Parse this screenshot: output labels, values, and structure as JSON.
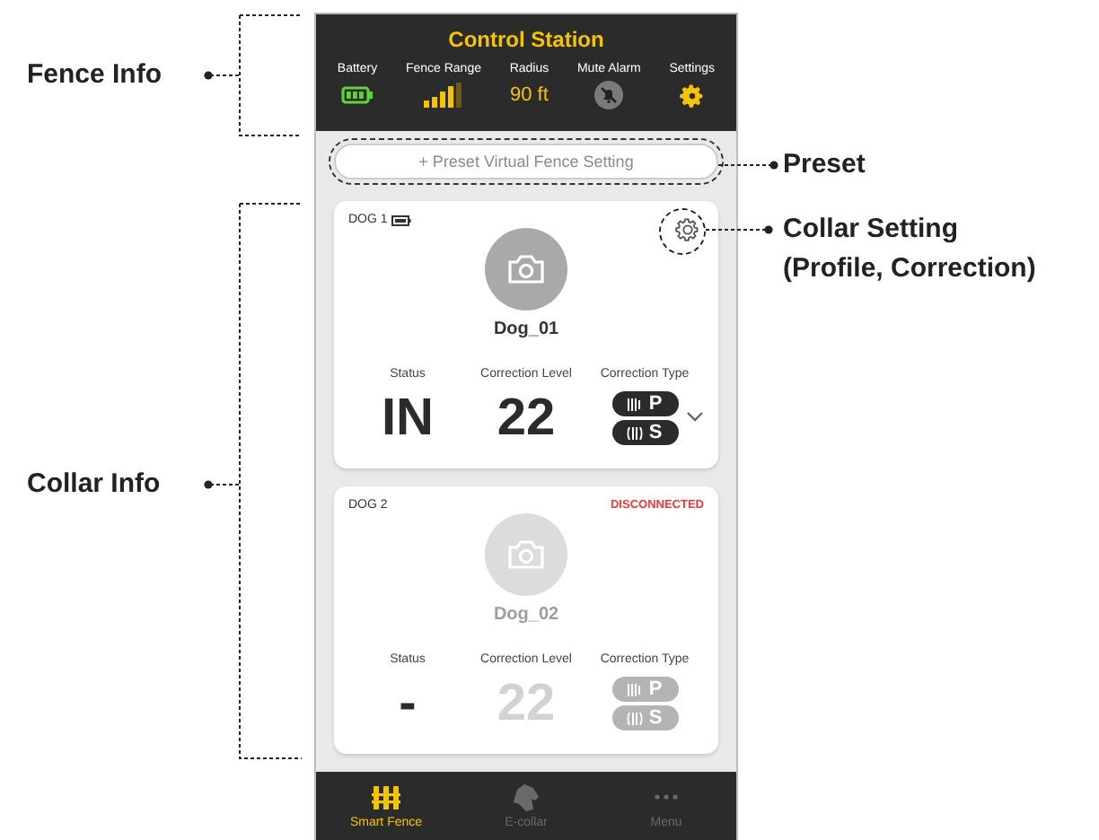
{
  "annotations": [
    {
      "kind": "fence_info",
      "label": "Fence Info"
    },
    {
      "kind": "preset",
      "label": "Preset"
    },
    {
      "kind": "collar_setting",
      "label": "Collar Setting",
      "sublabel": "(Profile, Correction)"
    },
    {
      "kind": "collar_info",
      "label": "Collar Info"
    }
  ],
  "header": {
    "title": "Control Station",
    "stats": [
      {
        "kind": "battery",
        "label": "Battery"
      },
      {
        "kind": "signal",
        "label": "Fence Range"
      },
      {
        "kind": "text",
        "label": "Radius",
        "value": "90 ft"
      },
      {
        "kind": "mute",
        "label": "Mute Alarm"
      },
      {
        "kind": "gear",
        "label": "Settings"
      }
    ]
  },
  "preset_button": "+ Preset Virtual Fence Setting",
  "collars": [
    {
      "name": "DOG 1",
      "connected": true,
      "photo_label": "Dog_01",
      "status_label": "Status",
      "status": "IN",
      "level_label": "Correction Level",
      "level_value": "22",
      "type_label": "Correction Type",
      "types": [
        "P",
        "S"
      ]
    },
    {
      "name": "DOG 2",
      "connected": false,
      "alert": "DISCONNECTED",
      "photo_label": "Dog_02",
      "status_label": "Status",
      "status": "-",
      "level_label": "Correction Level",
      "level_value": "22",
      "type_label": "Correction Type",
      "types": [
        "P",
        "S"
      ]
    }
  ],
  "nav": [
    {
      "kind": "fence",
      "label": "Smart Fence",
      "selected": true
    },
    {
      "kind": "dog",
      "label": "E-collar",
      "selected": false
    },
    {
      "kind": "more",
      "label": "Menu",
      "selected": false
    }
  ]
}
